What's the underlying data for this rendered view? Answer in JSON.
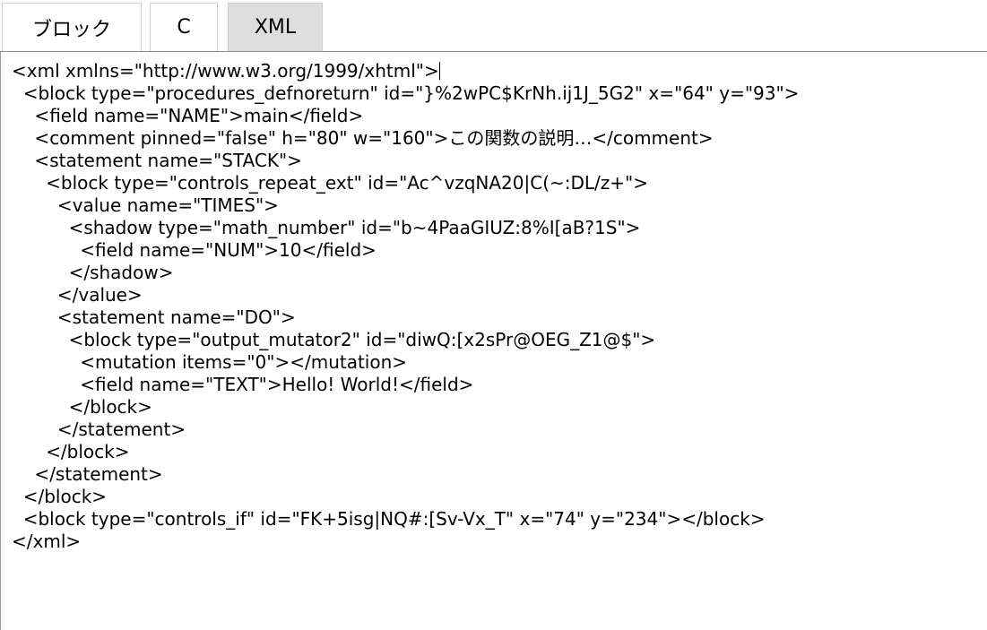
{
  "tabs": [
    {
      "label": "ブロック",
      "active": false
    },
    {
      "label": "C",
      "active": false
    },
    {
      "label": "XML",
      "active": true
    }
  ],
  "colors": {
    "active_tab": "#dedede",
    "border": "#8e8e8e",
    "text": "#000000"
  },
  "editor": {
    "lines": [
      "<xml xmlns=\"http://www.w3.org/1999/xhtml\">",
      "  <block type=\"procedures_defnoreturn\" id=\"}%2wPC$KrNh.ij1J_5G2\" x=\"64\" y=\"93\">",
      "    <field name=\"NAME\">main</field>",
      "    <comment pinned=\"false\" h=\"80\" w=\"160\">この関数の説明…</comment>",
      "    <statement name=\"STACK\">",
      "      <block type=\"controls_repeat_ext\" id=\"Ac^vzqNA20|C(~:DL/z+\">",
      "        <value name=\"TIMES\">",
      "          <shadow type=\"math_number\" id=\"b~4PaaGIUZ:8%I[aB?1S\">",
      "            <field name=\"NUM\">10</field>",
      "          </shadow>",
      "        </value>",
      "        <statement name=\"DO\">",
      "          <block type=\"output_mutator2\" id=\"diwQ:[x2sPr@OEG_Z1@$\">",
      "            <mutation items=\"0\"></mutation>",
      "            <field name=\"TEXT\">Hello! World!</field>",
      "          </block>",
      "        </statement>",
      "      </block>",
      "    </statement>",
      "  </block>",
      "  <block type=\"controls_if\" id=\"FK+5isg|NQ#:[Sv-Vx_T\" x=\"74\" y=\"234\"></block>",
      "</xml>"
    ]
  }
}
